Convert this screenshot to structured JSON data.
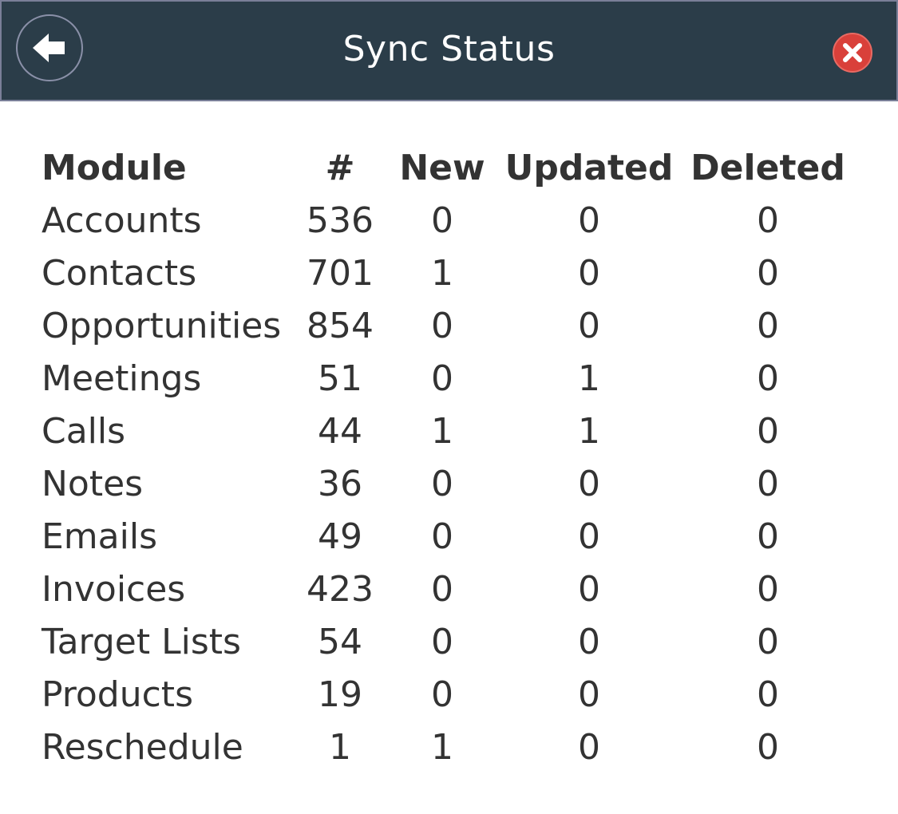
{
  "header": {
    "title": "Sync Status",
    "back_icon": "back-arrow-icon",
    "close_icon": "close-icon",
    "background_color": "#2b3d49",
    "close_color": "#d9403a"
  },
  "table": {
    "columns": [
      "Module",
      "#",
      "New",
      "Updated",
      "Deleted"
    ],
    "rows": [
      {
        "module": "Accounts",
        "count": "536",
        "new": "0",
        "updated": "0",
        "deleted": "0"
      },
      {
        "module": "Contacts",
        "count": "701",
        "new": "1",
        "updated": "0",
        "deleted": "0"
      },
      {
        "module": "Opportunities",
        "count": "854",
        "new": "0",
        "updated": "0",
        "deleted": "0"
      },
      {
        "module": "Meetings",
        "count": "51",
        "new": "0",
        "updated": "1",
        "deleted": "0"
      },
      {
        "module": "Calls",
        "count": "44",
        "new": "1",
        "updated": "1",
        "deleted": "0"
      },
      {
        "module": "Notes",
        "count": "36",
        "new": "0",
        "updated": "0",
        "deleted": "0"
      },
      {
        "module": "Emails",
        "count": "49",
        "new": "0",
        "updated": "0",
        "deleted": "0"
      },
      {
        "module": "Invoices",
        "count": "423",
        "new": "0",
        "updated": "0",
        "deleted": "0"
      },
      {
        "module": "Target Lists",
        "count": "54",
        "new": "0",
        "updated": "0",
        "deleted": "0"
      },
      {
        "module": "Products",
        "count": "19",
        "new": "0",
        "updated": "0",
        "deleted": "0"
      },
      {
        "module": "Reschedule",
        "count": "1",
        "new": "1",
        "updated": "0",
        "deleted": "0"
      }
    ]
  }
}
